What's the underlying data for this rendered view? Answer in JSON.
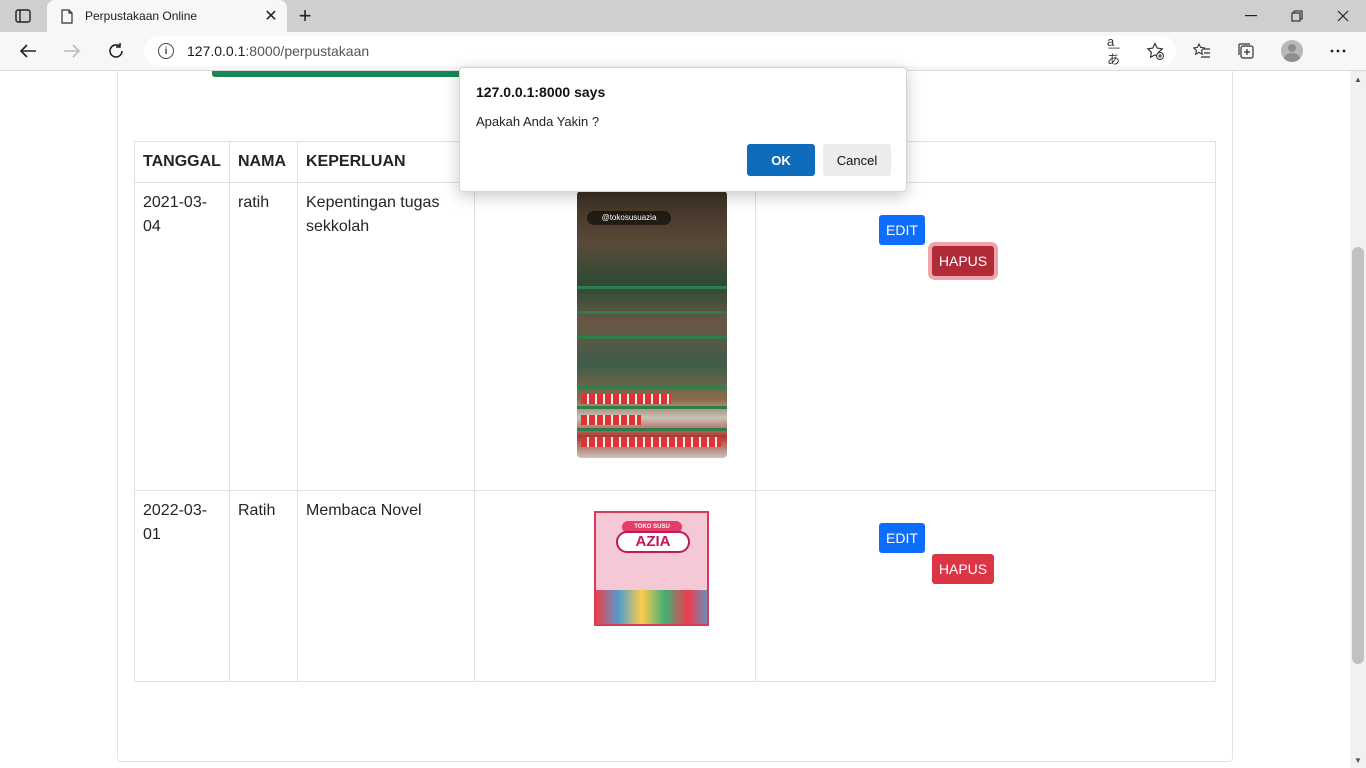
{
  "browser": {
    "tab_title": "Perpustakaan Online",
    "url_host": "127.0.0.1",
    "url_rest": ":8000/perpustakaan"
  },
  "table": {
    "headers": [
      "TANGGAL",
      "NAMA",
      "KEPERLUAN"
    ],
    "rows": [
      {
        "tanggal": "2021-03-04",
        "nama": "ratih",
        "keperluan": "Kepentingan tugas sekkolah",
        "edit": "EDIT",
        "hapus": "HAPUS"
      },
      {
        "tanggal": "2022-03-01",
        "nama": "Ratih",
        "keperluan": "Membaca Novel",
        "edit": "EDIT",
        "hapus": "HAPUS"
      }
    ]
  },
  "images": {
    "photo1_tag": "@tokosusuazia",
    "photo2_banner": "TOKO SUSU",
    "photo2_brand": "AZIA"
  },
  "dialog": {
    "origin": "127.0.0.1:8000 says",
    "message": "Apakah Anda Yakin ?",
    "ok_label": "OK",
    "cancel_label": "Cancel"
  },
  "colors": {
    "edit_button": "#0d6efd",
    "hapus_button": "#dc3545",
    "ok_button": "#0f6cbd",
    "accent_bar": "#198754"
  }
}
